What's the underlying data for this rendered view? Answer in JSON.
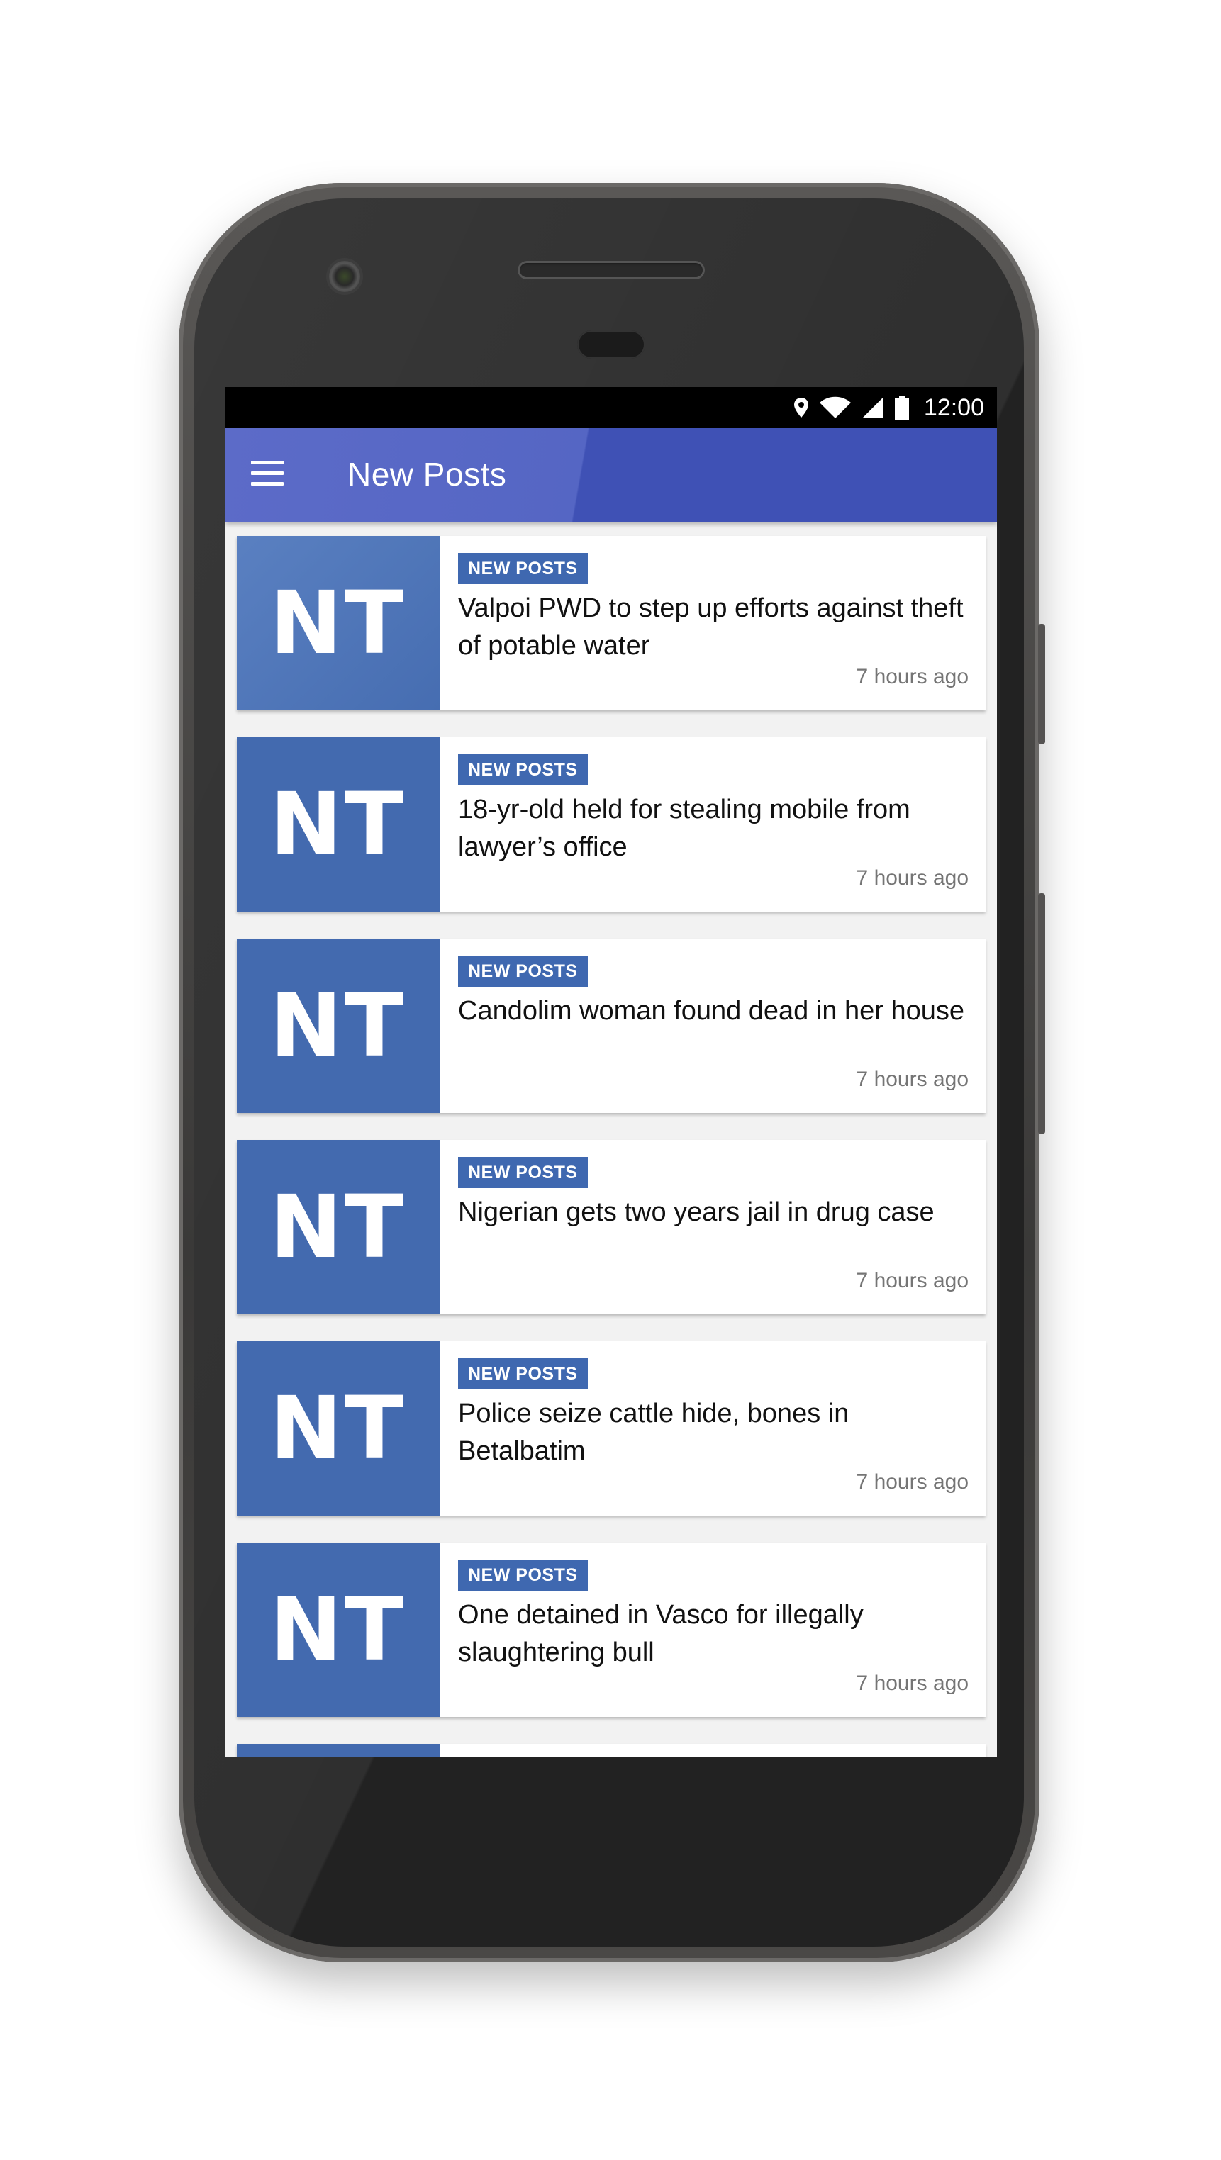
{
  "status_bar": {
    "time": "12:00",
    "icons": [
      "location-icon",
      "wifi-icon",
      "signal-icon",
      "battery-icon"
    ]
  },
  "app_bar": {
    "title": "New Posts",
    "menu_icon": "hamburger-menu-icon"
  },
  "colors": {
    "app_bar": "#3f51b5",
    "thumbnail": "#436aaf",
    "badge": "#3f68b0"
  },
  "posts": [
    {
      "thumb_label": "NT",
      "category": "NEW POSTS",
      "headline": "Valpoi PWD to step up efforts against theft of potable water",
      "time": "7 hours ago"
    },
    {
      "thumb_label": "NT",
      "category": "NEW POSTS",
      "headline": "18-yr-old held for stealing  mobile from lawyer’s office",
      "time": "7 hours ago"
    },
    {
      "thumb_label": "NT",
      "category": "NEW POSTS",
      "headline": "Candolim woman found  dead in her house",
      "time": "7 hours ago"
    },
    {
      "thumb_label": "NT",
      "category": "NEW POSTS",
      "headline": "Nigerian gets two  years jail in drug case",
      "time": "7 hours ago"
    },
    {
      "thumb_label": "NT",
      "category": "NEW POSTS",
      "headline": "Police seize cattle hide, bones in Betalbatim",
      "time": "7 hours ago"
    },
    {
      "thumb_label": "NT",
      "category": "NEW POSTS",
      "headline": "One detained in Vasco for illegally slaughtering bull",
      "time": "7 hours ago"
    }
  ]
}
